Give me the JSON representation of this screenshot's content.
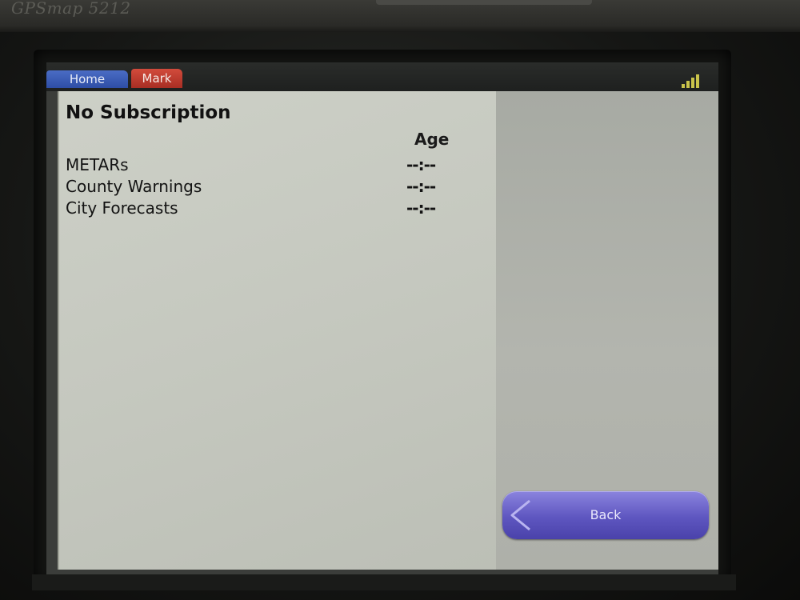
{
  "device": {
    "model_label": "GPSmap 5212"
  },
  "topbar": {
    "tabs": [
      {
        "label": "Home",
        "color": "#2e4ea6"
      },
      {
        "label": "Mark",
        "color": "#a82e24"
      }
    ],
    "signal_icon": "signal-strength-icon"
  },
  "content": {
    "title": "No Subscription",
    "column_header": "Age",
    "rows": [
      {
        "label": "METARs",
        "age": "--:--"
      },
      {
        "label": "County Warnings",
        "age": "--:--"
      },
      {
        "label": "City Forecasts",
        "age": "--:--"
      }
    ]
  },
  "side_panel": {
    "back_label": "Back",
    "back_icon": "chevron-left-icon",
    "button_color": "#5e56c0"
  }
}
